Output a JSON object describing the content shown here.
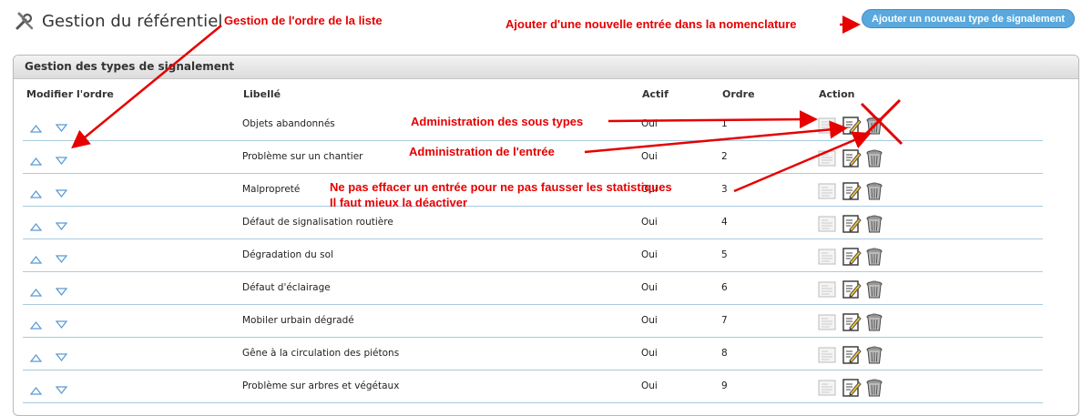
{
  "page": {
    "title": "Gestion du référentiel",
    "add_button_label": "Ajouter un nouveau type de signalement",
    "tool_icon": "tools-icon"
  },
  "panel": {
    "title": "Gestion des types de signalement",
    "columns": {
      "reorder": "Modifier l'ordre",
      "label": "Libellé",
      "active": "Actif",
      "order": "Ordre",
      "action": "Action"
    }
  },
  "rows": [
    {
      "label": "Objets abandonnés",
      "active": "Oui",
      "order": "1"
    },
    {
      "label": "Problème sur un chantier",
      "active": "Oui",
      "order": "2"
    },
    {
      "label": "Malpropreté",
      "active": "Oui",
      "order": "3"
    },
    {
      "label": "Défaut de signalisation routière",
      "active": "Oui",
      "order": "4"
    },
    {
      "label": "Dégradation du sol",
      "active": "Oui",
      "order": "5"
    },
    {
      "label": "Défaut d'éclairage",
      "active": "Oui",
      "order": "6"
    },
    {
      "label": "Mobiler urbain dégradé",
      "active": "Oui",
      "order": "7"
    },
    {
      "label": "Gêne à la circulation des piétons",
      "active": "Oui",
      "order": "8"
    },
    {
      "label": "Problème sur arbres et végétaux",
      "active": "Oui",
      "order": "9"
    }
  ],
  "row_icons": {
    "up": "arrow-up-icon",
    "down": "arrow-down-icon",
    "subtypes": "subtypes-icon",
    "edit": "edit-icon",
    "delete": "trash-icon"
  },
  "annotations": {
    "order": "Gestion de l'ordre de la liste",
    "add": "Ajouter d'une nouvelle entrée dans la nomenclature",
    "subtypes": "Administration des sous types",
    "entry": "Administration de l'entrée",
    "delete_line1": "Ne pas effacer un entrée pour ne pas fausser les statistiques",
    "delete_line2": "Il faut mieux la déactiver"
  },
  "colors": {
    "annotation": "#e60000",
    "accent_button": "#5aa9de",
    "row_border": "#a9cbe0",
    "arrow": "#5b9bd5"
  }
}
